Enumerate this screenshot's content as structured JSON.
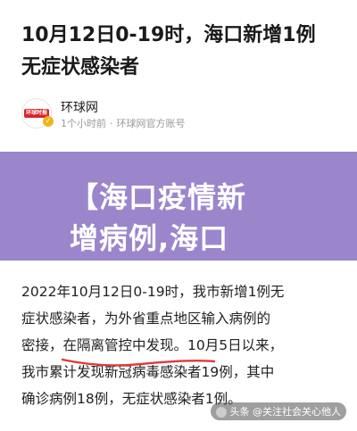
{
  "article": {
    "headline_line1": "10月12日0-19时，海口新增1例",
    "headline_line2": "无症状感染者"
  },
  "source": {
    "logo_text": "环球时报",
    "name": "环球网",
    "time": "1个小时前",
    "account": "环球网官方账号"
  },
  "banner": {
    "line1": "【海口疫情新",
    "line2": "增病例,海口"
  },
  "body": {
    "line1": "2022年10月12日0-19时，我市新增1例无",
    "line2": "症状感染者，为外省重点地区输入病例的",
    "line3": "密接，在隔离管控中发现。10月5日以来，",
    "line4": "我市累计发现新冠病毒感染者19例，其中",
    "line5": "确诊病例18例，无症状感染者1例。"
  },
  "watermark": {
    "text": "头条 @关注社会关心他人"
  },
  "colors": {
    "banner_bg": "#9b86cc",
    "underline": "#e03a3a"
  }
}
